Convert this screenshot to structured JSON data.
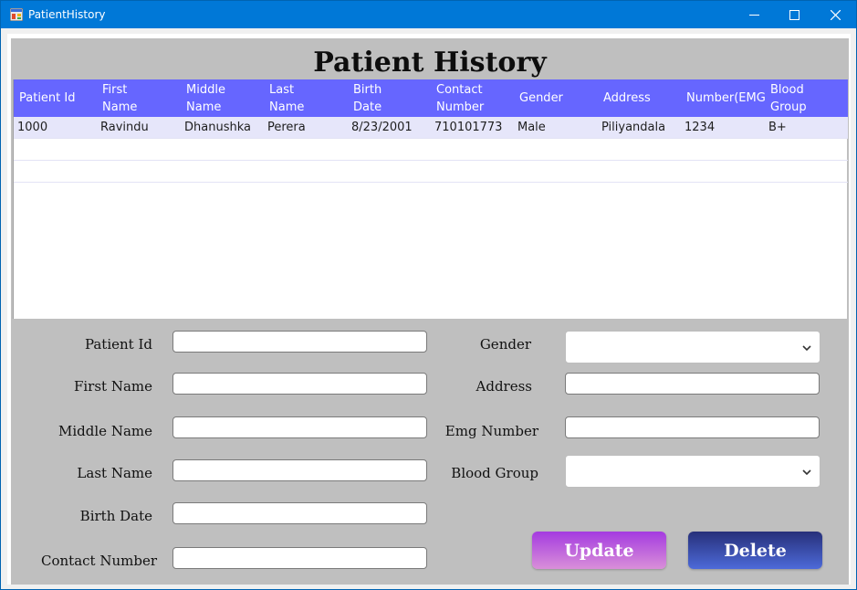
{
  "window": {
    "title": "PatientHistory"
  },
  "page": {
    "title": "Patient History"
  },
  "grid": {
    "columns": [
      "Patient Id",
      "First\nName",
      "Middle\nName",
      "Last\nName",
      "Birth\nDate",
      "Contact\nNumber",
      "Gender",
      "Address",
      "Number(EMG",
      "Blood\nGroup"
    ],
    "rows": [
      [
        "1000",
        "Ravindu",
        "Dhanushka",
        "Perera",
        "8/23/2001",
        "710101773",
        "Male",
        "Piliyandala",
        "1234",
        "B+"
      ]
    ],
    "header_color": "#6666ff",
    "selected_row_color": "#e6e6fa"
  },
  "form": {
    "labels": {
      "patient_id": "Patient Id",
      "first_name": "First Name",
      "middle_name": "Middle Name",
      "last_name": "Last Name",
      "birth_date": "Birth Date",
      "contact_number": "Contact Number",
      "gender": "Gender",
      "address": "Address",
      "emg_number": "Emg Number",
      "blood_group": "Blood Group"
    },
    "values": {
      "patient_id": "",
      "first_name": "",
      "middle_name": "",
      "last_name": "",
      "birth_date": "",
      "contact_number": "",
      "gender": "",
      "address": "",
      "emg_number": "",
      "blood_group": ""
    }
  },
  "buttons": {
    "update": "Update",
    "delete": "Delete"
  }
}
